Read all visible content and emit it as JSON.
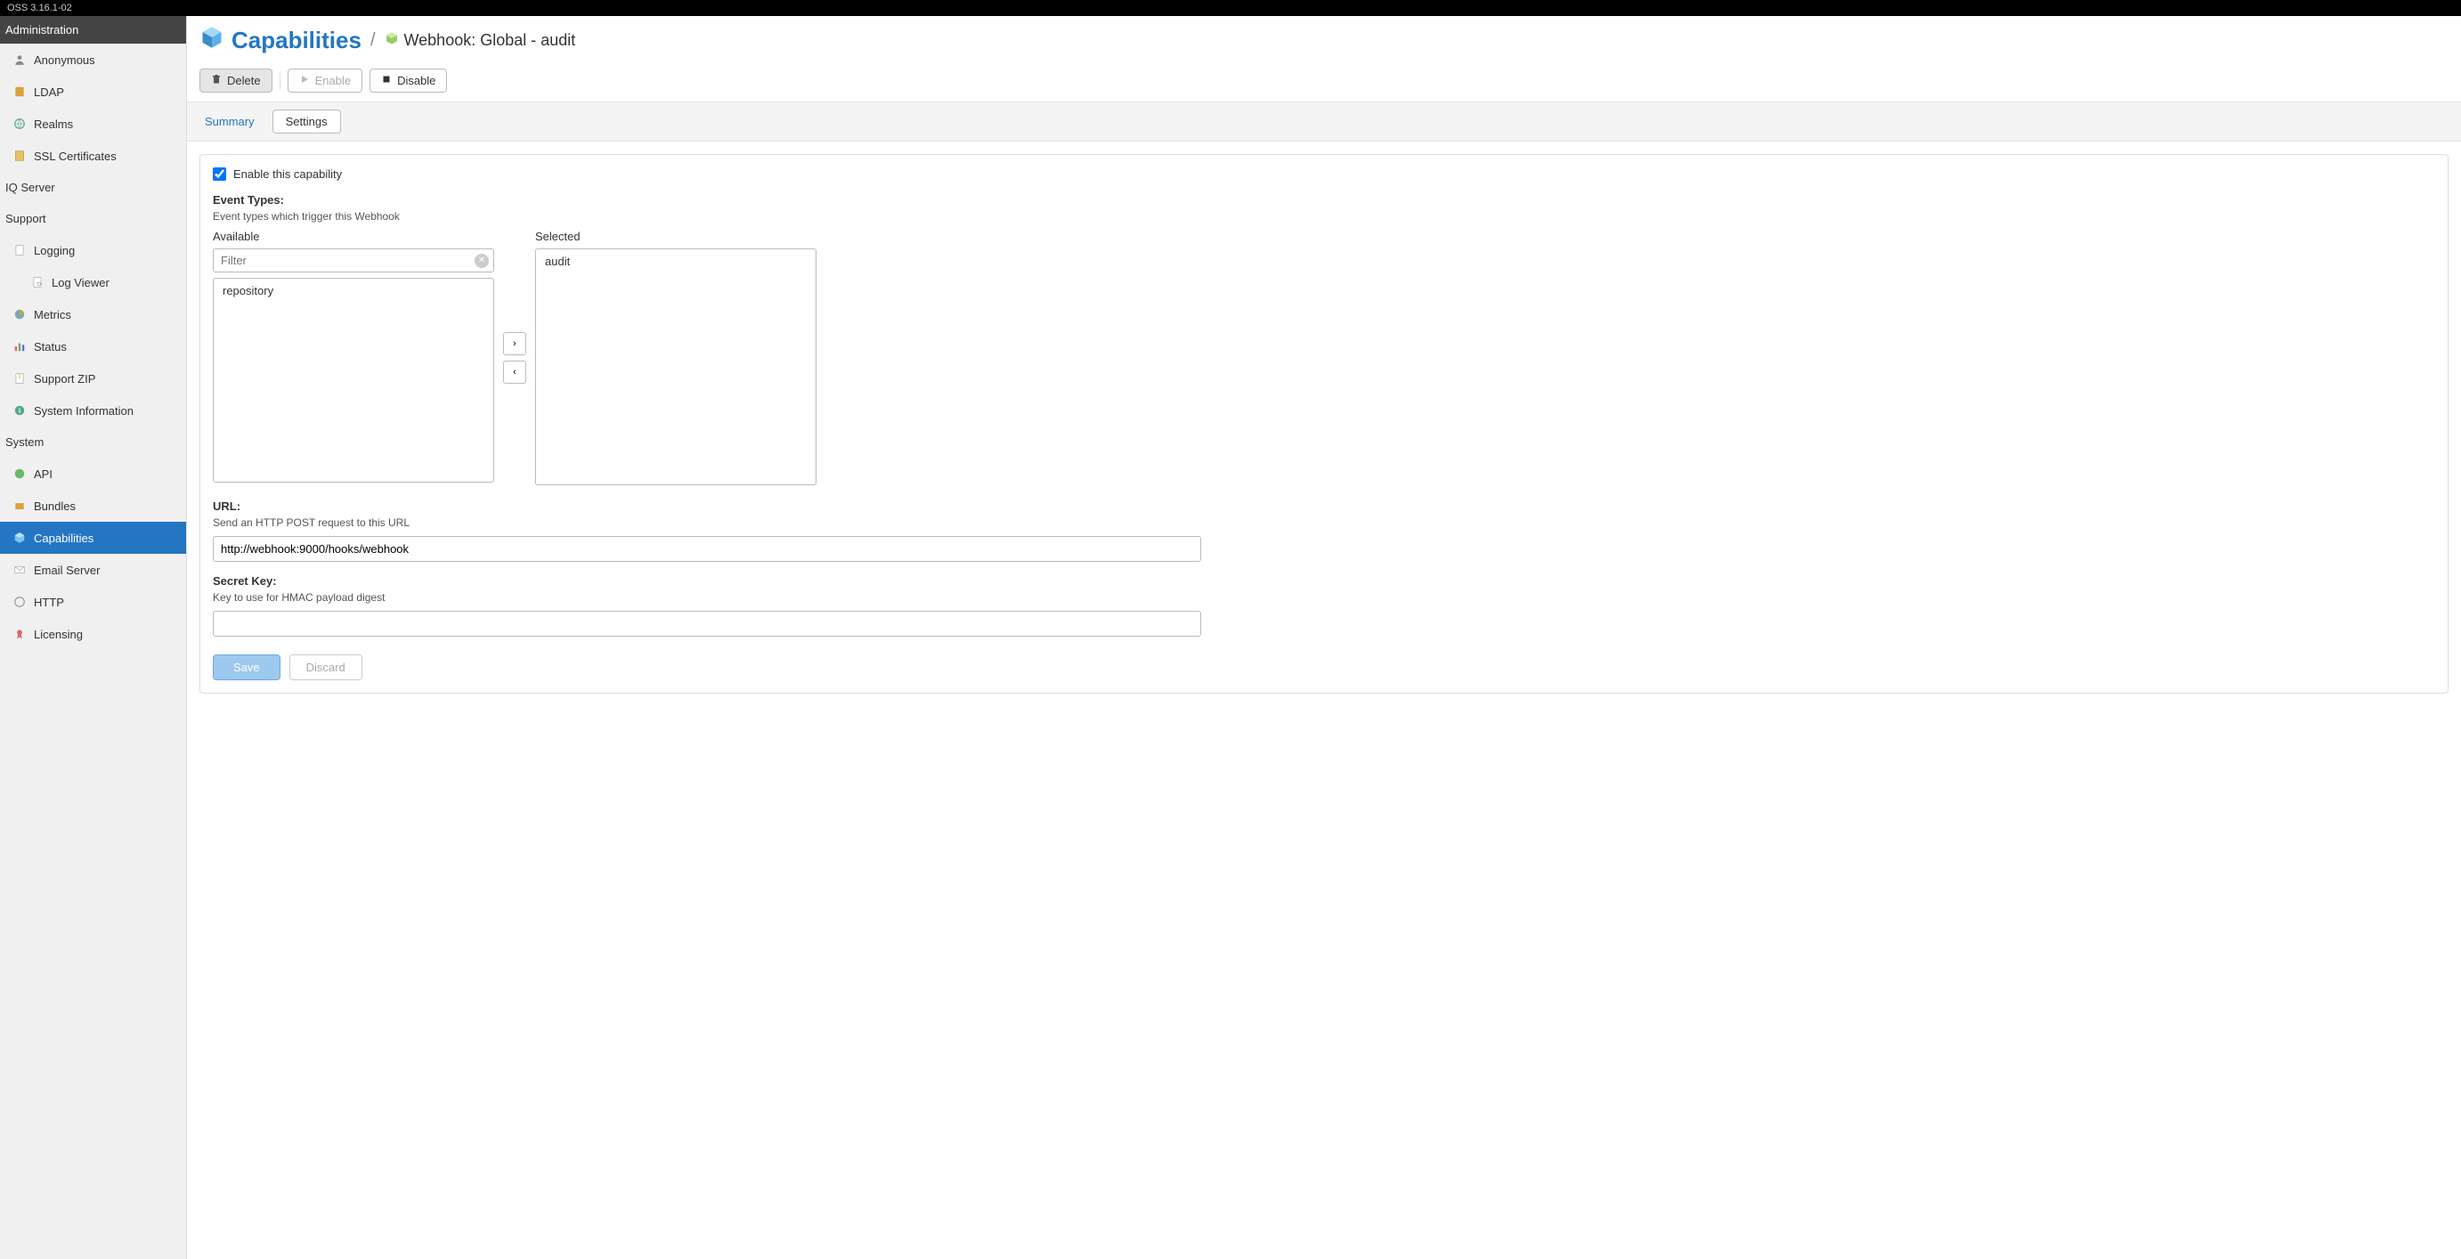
{
  "topbar": {
    "version": "OSS 3.16.1-02"
  },
  "sidebar": {
    "header": "Administration",
    "items": [
      {
        "label": "Anonymous",
        "icon": "user"
      },
      {
        "label": "LDAP",
        "icon": "book"
      },
      {
        "label": "Realms",
        "icon": "globe"
      },
      {
        "label": "SSL Certificates",
        "icon": "cert"
      }
    ],
    "group_iq": "IQ Server",
    "group_support": "Support",
    "support_items": [
      {
        "label": "Logging",
        "icon": "doc"
      },
      {
        "label": "Log Viewer",
        "icon": "doc-view",
        "child": true
      },
      {
        "label": "Metrics",
        "icon": "chart"
      },
      {
        "label": "Status",
        "icon": "bars"
      },
      {
        "label": "Support ZIP",
        "icon": "zip"
      },
      {
        "label": "System Information",
        "icon": "info"
      }
    ],
    "group_system": "System",
    "system_items": [
      {
        "label": "API",
        "icon": "api"
      },
      {
        "label": "Bundles",
        "icon": "bundle"
      },
      {
        "label": "Capabilities",
        "icon": "cube",
        "active": true
      },
      {
        "label": "Email Server",
        "icon": "mail"
      },
      {
        "label": "HTTP",
        "icon": "http"
      },
      {
        "label": "Licensing",
        "icon": "license"
      }
    ]
  },
  "breadcrumb": {
    "title": "Capabilities",
    "subtitle": "Webhook: Global - audit"
  },
  "toolbar": {
    "delete": "Delete",
    "enable": "Enable",
    "disable": "Disable"
  },
  "tabs": {
    "summary": "Summary",
    "settings": "Settings"
  },
  "form": {
    "enable_checkbox": "Enable this capability",
    "enable_checked": true,
    "event_types_label": "Event Types:",
    "event_types_help": "Event types which trigger this Webhook",
    "available_label": "Available",
    "selected_label": "Selected",
    "filter_placeholder": "Filter",
    "available_items": [
      "repository"
    ],
    "selected_items": [
      "audit"
    ],
    "url_label": "URL:",
    "url_help": "Send an HTTP POST request to this URL",
    "url_value": "http://webhook:9000/hooks/webhook",
    "secret_label": "Secret Key:",
    "secret_help": "Key to use for HMAC payload digest",
    "secret_value": "",
    "save": "Save",
    "discard": "Discard"
  }
}
